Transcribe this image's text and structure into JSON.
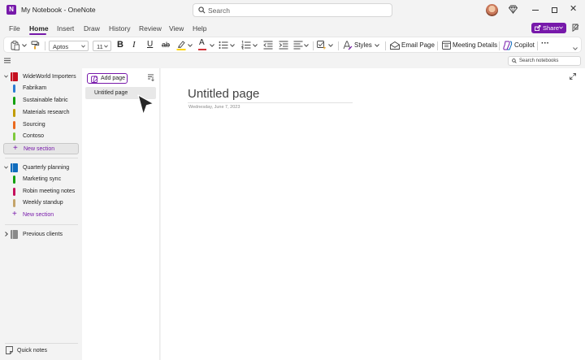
{
  "window": {
    "title": "My Notebook - OneNote",
    "app_icon": "N",
    "search_placeholder": "Search",
    "controls": [
      "minimize",
      "maximize",
      "close"
    ]
  },
  "menu": {
    "tabs": [
      "File",
      "Home",
      "Insert",
      "Draw",
      "History",
      "Review",
      "View",
      "Help"
    ],
    "active_tab": "Home",
    "share_label": "Share"
  },
  "ribbon": {
    "font_name": "Aptos",
    "font_size": "11",
    "bold": "B",
    "italic": "I",
    "underline": "U",
    "strikethrough": "ab",
    "highlight_letter": "",
    "font_color_letter": "A",
    "styles_label": "Styles",
    "email_page_label": "Email Page",
    "meeting_details_label": "Meeting Details",
    "copilot_label": "Copilot",
    "more": "···"
  },
  "search_notebooks_placeholder": "Search notebooks",
  "nav": {
    "notebooks": [
      {
        "name": "WideWorld Importers",
        "color": "#c50f1f",
        "expanded": true,
        "sections": [
          {
            "name": "Fabrikam",
            "color": "#2b7cd3"
          },
          {
            "name": "Sustainable fabric",
            "color": "#13a10e"
          },
          {
            "name": "Materials research",
            "color": "#c19c00"
          },
          {
            "name": "Sourcing",
            "color": "#ea6a1f"
          },
          {
            "name": "Contoso",
            "color": "#7ec93c"
          }
        ],
        "new_section_label": "New section"
      },
      {
        "name": "Quarterly planning",
        "color": "#0f6cbd",
        "expanded": true,
        "sections": [
          {
            "name": "Marketing sync",
            "color": "#13a10e"
          },
          {
            "name": "Robin meeting notes",
            "color": "#c50f5c"
          },
          {
            "name": "Weekly standup",
            "color": "#c4a46a"
          }
        ],
        "new_section_label": "New section"
      },
      {
        "name": "Previous clients",
        "color": "#8a8a8a",
        "expanded": false,
        "sections": []
      }
    ],
    "quick_notes_label": "Quick notes"
  },
  "pages": {
    "add_page_label": "Add page",
    "items": [
      "Untitled page"
    ]
  },
  "canvas": {
    "title": "Untitled page",
    "date": "Wednesday, June 7, 2023"
  },
  "colors": {
    "accent": "#7719aa",
    "font_color_underline": "#d13438",
    "highlight_underline": "#ffd400"
  }
}
